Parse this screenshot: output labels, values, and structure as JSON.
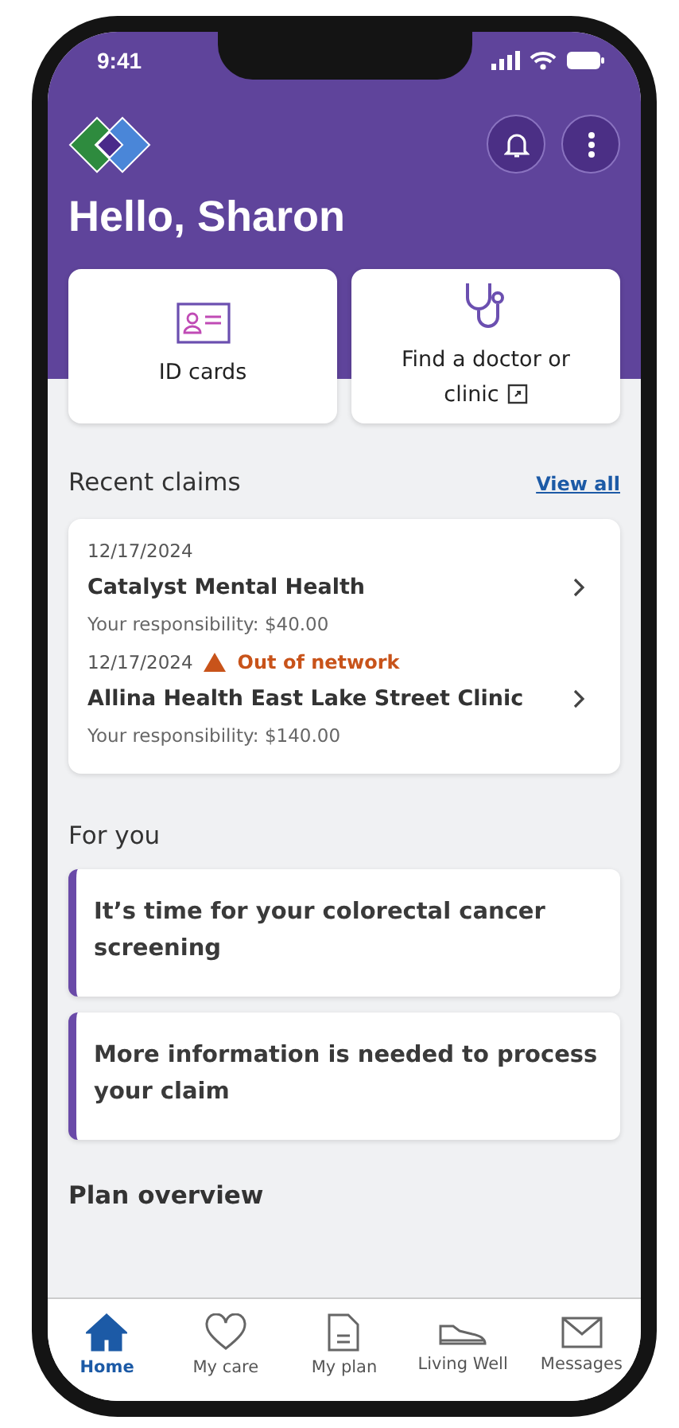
{
  "status_bar": {
    "time": "9:41"
  },
  "header": {
    "greeting": "Hello, Sharon"
  },
  "quick_actions": [
    {
      "kind": "id-card",
      "label": "ID cards",
      "external": false
    },
    {
      "kind": "doctor",
      "label": "Find a doctor or clinic",
      "external": true
    }
  ],
  "recent_claims": {
    "title": "Recent claims",
    "view_all": "View all",
    "claims": [
      {
        "date": "12/17/2024",
        "provider": "Catalyst Mental Health",
        "responsibility": "Your responsibility: $40.00"
      },
      {
        "date": "12/17/2024",
        "warning": "Out of network",
        "provider": "Allina Health East Lake Street Clinic",
        "responsibility": "Your responsibility: $140.00"
      }
    ]
  },
  "for_you": {
    "title": "For you",
    "cards": [
      {
        "text": "It’s time for your colorectal cancer screening"
      },
      {
        "text": "More information is needed to process your claim"
      }
    ]
  },
  "plan_overview": {
    "title": "Plan overview"
  },
  "nav": [
    {
      "kind": "home",
      "label": "Home",
      "selected": true
    },
    {
      "kind": "care",
      "label": "My care",
      "selected": false
    },
    {
      "kind": "plan",
      "label": "My plan",
      "selected": false
    },
    {
      "kind": "wellness",
      "label": "Living Well",
      "selected": false
    },
    {
      "kind": "messages",
      "label": "Messages",
      "selected": false
    }
  ]
}
